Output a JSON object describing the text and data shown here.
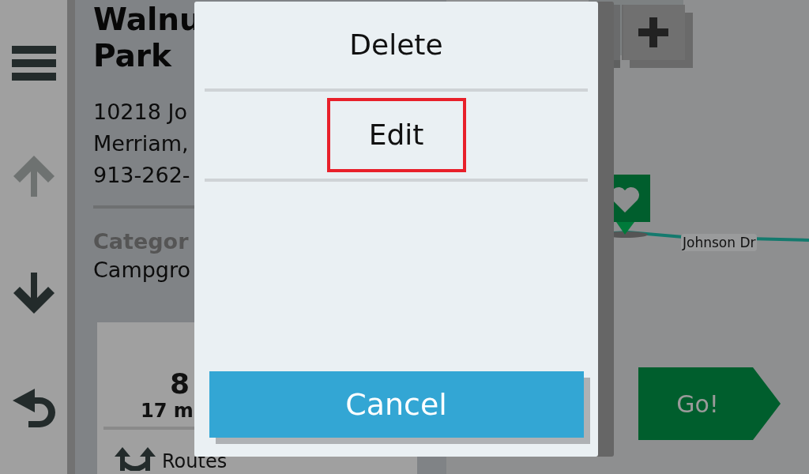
{
  "sidebar": {
    "buttons": [
      {
        "kind": "menu",
        "disabled": false
      },
      {
        "kind": "up",
        "disabled": true
      },
      {
        "kind": "down",
        "disabled": false
      },
      {
        "kind": "back",
        "disabled": false
      }
    ]
  },
  "detail": {
    "title_lines": [
      "Walnu",
      "Park"
    ],
    "address_lines": [
      "10218 Jo",
      "Merriam,",
      "913-262-"
    ],
    "category_label": "Categor",
    "category_value": "Campgro",
    "summary": {
      "value": "8",
      "subvalue": "17 m"
    },
    "routes_label": "Routes"
  },
  "map": {
    "road_label": "Johnson Dr",
    "go_button": "Go!"
  },
  "dialog": {
    "items": [
      {
        "label": "Delete",
        "highlighted": false
      },
      {
        "label": "Edit",
        "highlighted": true
      }
    ],
    "cancel": "Cancel"
  }
}
